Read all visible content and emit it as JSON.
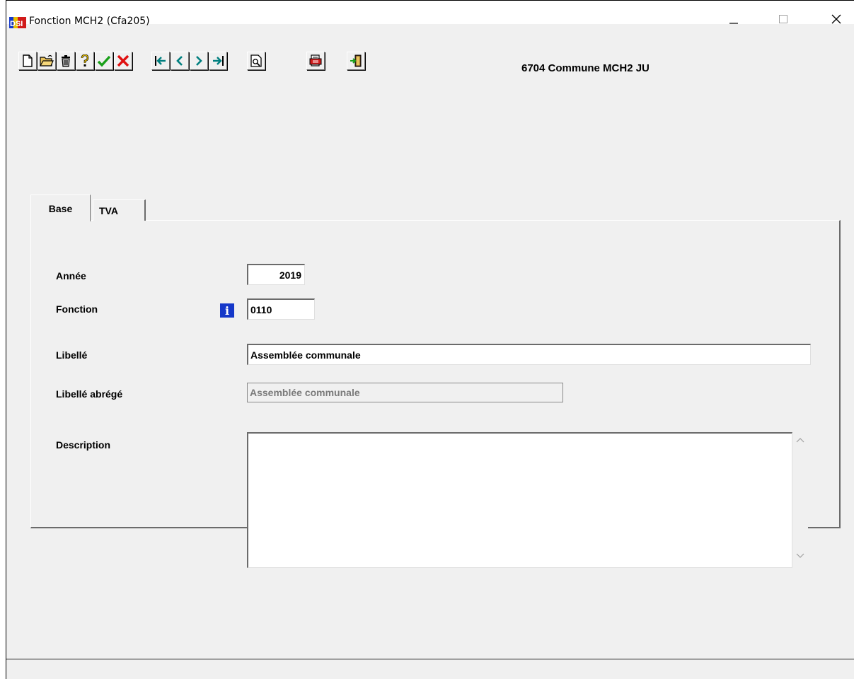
{
  "window": {
    "title": "Fonction MCH2 (Cfa205)",
    "app_logo": "DSI"
  },
  "window_controls": {
    "minimize": "minimize-icon",
    "maximize": "maximize-icon",
    "close": "close-icon"
  },
  "toolbar": {
    "buttons": [
      {
        "name": "new-document",
        "icon": "blank-page-icon"
      },
      {
        "name": "open",
        "icon": "open-folder-icon"
      },
      {
        "name": "delete",
        "icon": "trash-icon"
      },
      {
        "name": "help",
        "icon": "question-icon"
      },
      {
        "name": "validate",
        "icon": "checkmark-icon"
      },
      {
        "name": "cancel",
        "icon": "red-x-icon"
      },
      {
        "name": "first-record",
        "icon": "first-arrow-icon"
      },
      {
        "name": "previous-record",
        "icon": "previous-arrow-icon"
      },
      {
        "name": "next-record",
        "icon": "next-arrow-icon"
      },
      {
        "name": "last-record",
        "icon": "last-arrow-icon"
      },
      {
        "name": "preview",
        "icon": "print-preview-icon"
      },
      {
        "name": "print",
        "icon": "printer-icon"
      },
      {
        "name": "exit",
        "icon": "exit-door-icon"
      }
    ],
    "accent_green": "#19a019",
    "accent_red": "#e01010",
    "accent_teal": "#007f7f"
  },
  "company": "6704 Commune MCH2 JU",
  "tabs": [
    {
      "label": "Base",
      "active": true
    },
    {
      "label": "TVA",
      "active": false
    }
  ],
  "form": {
    "annee": {
      "label": "Année",
      "value": "2019"
    },
    "fonction": {
      "label": "Fonction",
      "value": "0110",
      "info_icon": "i"
    },
    "libelle": {
      "label": "Libellé",
      "value": "Assemblée communale"
    },
    "libelle_abrege": {
      "label": "Libellé abrégé",
      "value": "Assemblée communale"
    },
    "description": {
      "label": "Description",
      "value": ""
    }
  },
  "colors": {
    "info_icon_bg": "#1538c9",
    "window_bg": "#f0f0f0"
  }
}
